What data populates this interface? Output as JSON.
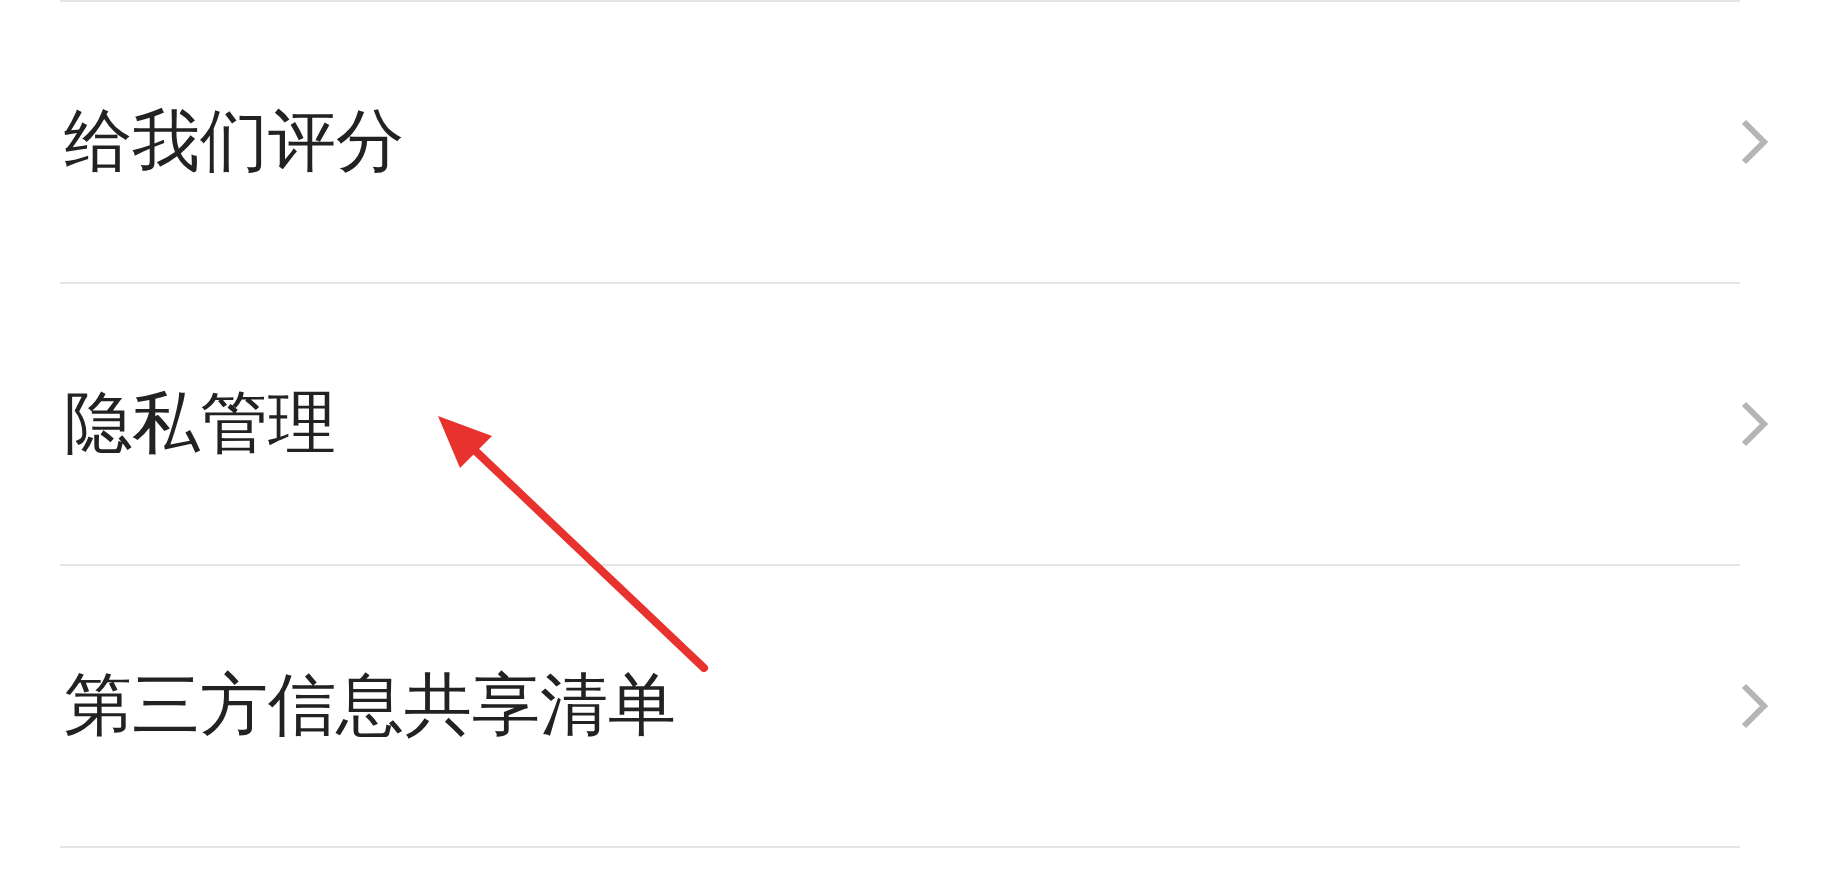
{
  "menu_items": [
    {
      "label": "给我们评分"
    },
    {
      "label": "隐私管理"
    },
    {
      "label": "第三方信息共享清单"
    }
  ]
}
